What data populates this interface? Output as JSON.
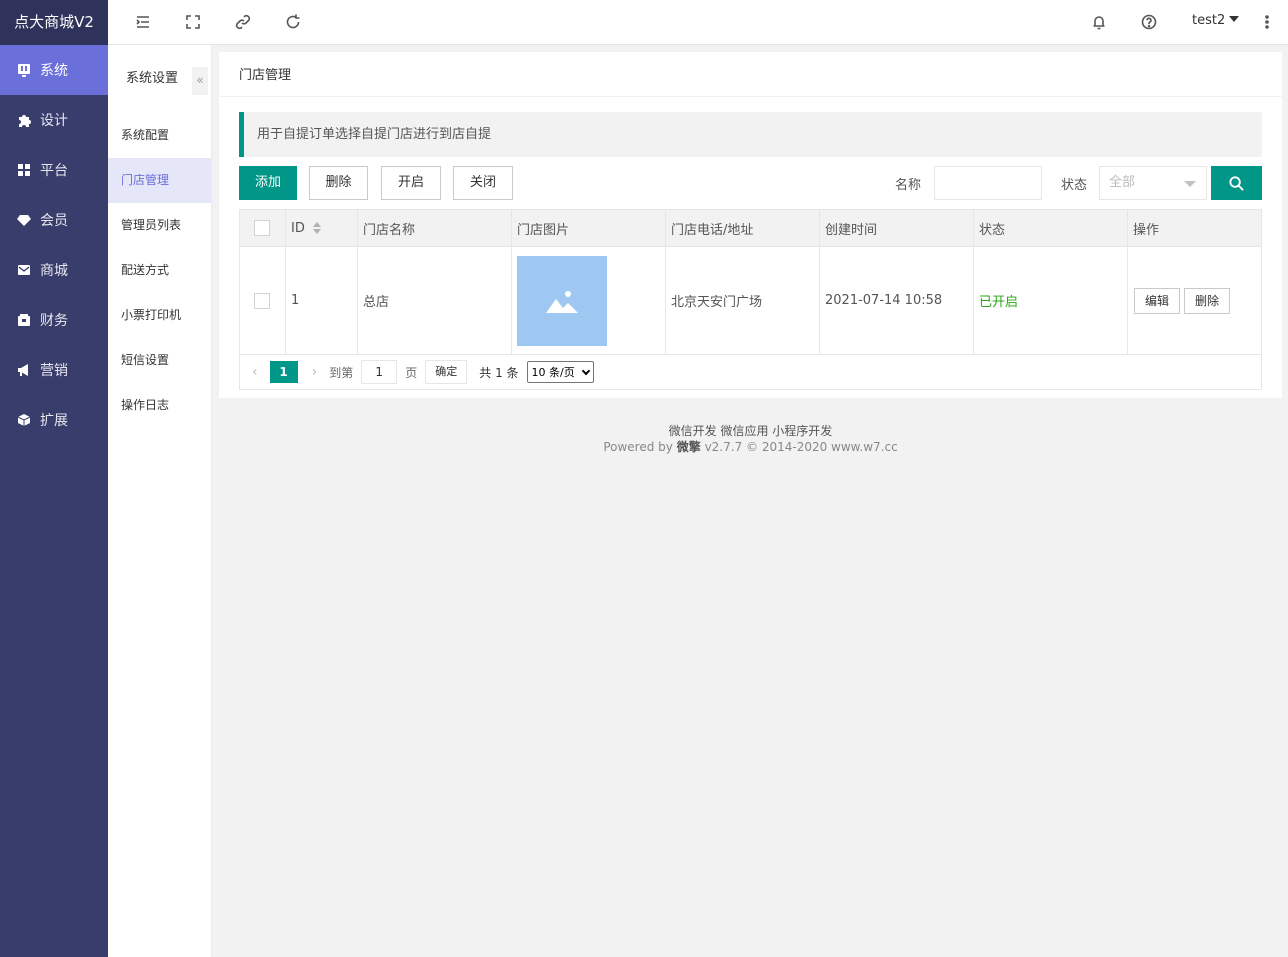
{
  "app": {
    "title": "点大商城V2"
  },
  "nav": [
    {
      "label": "系统",
      "icon": "system-icon",
      "active": true
    },
    {
      "label": "设计",
      "icon": "puzzle-icon"
    },
    {
      "label": "平台",
      "icon": "grid-icon"
    },
    {
      "label": "会员",
      "icon": "gem-icon"
    },
    {
      "label": "商城",
      "icon": "mail-icon"
    },
    {
      "label": "财务",
      "icon": "wallet-icon"
    },
    {
      "label": "营销",
      "icon": "megaphone-icon"
    },
    {
      "label": "扩展",
      "icon": "cube-icon"
    }
  ],
  "header": {
    "user": "test2"
  },
  "subnav": {
    "title": "系统设置",
    "collapse": "«",
    "items": [
      {
        "label": "系统配置"
      },
      {
        "label": "门店管理",
        "active": true
      },
      {
        "label": "管理员列表"
      },
      {
        "label": "配送方式"
      },
      {
        "label": "小票打印机"
      },
      {
        "label": "短信设置"
      },
      {
        "label": "操作日志"
      }
    ]
  },
  "page": {
    "title": "门店管理",
    "tip": "用于自提订单选择自提门店进行到店自提",
    "toolbar": {
      "add": "添加",
      "delete": "删除",
      "enable": "开启",
      "disable": "关闭"
    },
    "filters": {
      "name_label": "名称",
      "status_label": "状态",
      "status_value": "全部"
    }
  },
  "table": {
    "columns": [
      "ID",
      "门店名称",
      "门店图片",
      "门店电话/地址",
      "创建时间",
      "状态",
      "操作"
    ],
    "rows": [
      {
        "id": "1",
        "name": "总店",
        "address": "北京天安门广场",
        "created": "2021-07-14 10:58",
        "status": "已开启",
        "edit": "编辑",
        "delete": "删除"
      }
    ]
  },
  "pager": {
    "prev": "‹",
    "current": "1",
    "next": "›",
    "goto_label": "到第",
    "goto_value": "1",
    "page_label": "页",
    "confirm": "确定",
    "total": "共 1 条",
    "page_size": "10 条/页"
  },
  "footer": {
    "links": "微信开发 微信应用 小程序开发",
    "powered_prefix": "Powered by",
    "brand": "微擎",
    "version": "v2.7.7 © 2014-2020 www.w7.cc"
  },
  "colors": {
    "sidebar": "#393d6b",
    "active_nav": "#6a6fd9",
    "primary": "#009688",
    "status_on": "#2aa515"
  }
}
